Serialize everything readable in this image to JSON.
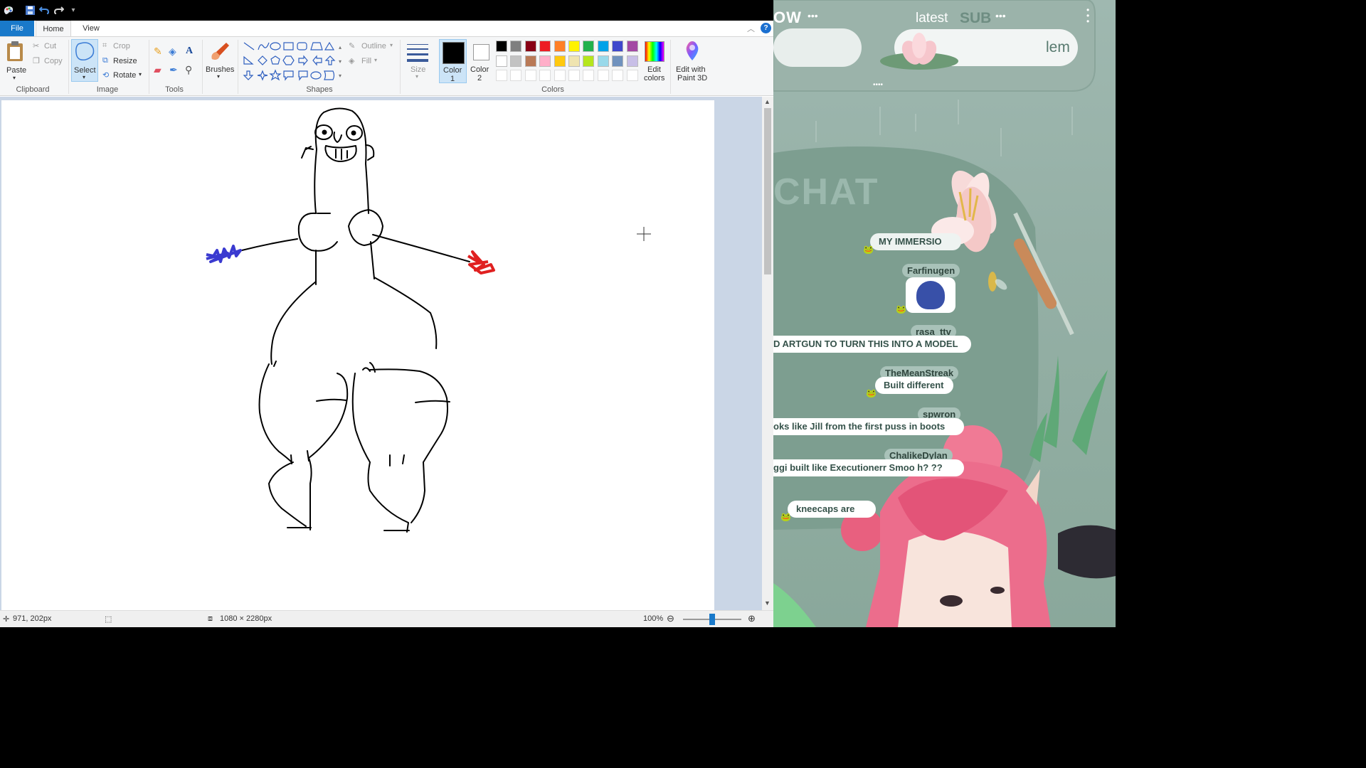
{
  "ribbon": {
    "tabs": [
      "File",
      "Home",
      "View"
    ],
    "clipboard": {
      "paste": "Paste",
      "cut": "Cut",
      "copy": "Copy",
      "group": "Clipboard"
    },
    "image": {
      "select": "Select",
      "crop": "Crop",
      "resize": "Resize",
      "rotate": "Rotate",
      "group": "Image"
    },
    "tools": {
      "group": "Tools"
    },
    "brushes": "Brushes",
    "shapes": {
      "outline": "Outline",
      "fill": "Fill",
      "group": "Shapes"
    },
    "size": "Size",
    "color1": {
      "line1": "Color",
      "line2": "1"
    },
    "color2": {
      "line1": "Color",
      "line2": "2"
    },
    "colors_group": "Colors",
    "edit_colors": {
      "line1": "Edit",
      "line2": "colors"
    },
    "paint3d": {
      "line1": "Edit with",
      "line2": "Paint 3D"
    },
    "palette": [
      "#000000",
      "#7f7f7f",
      "#880015",
      "#ed1c24",
      "#ff7f27",
      "#fff200",
      "#22b14c",
      "#00a2e8",
      "#3f48cc",
      "#a349a4",
      "#ffffff",
      "#c3c3c3",
      "#b97a57",
      "#ffaec9",
      "#ffc90e",
      "#efe4b0",
      "#b5e61d",
      "#99d9ea",
      "#7092be",
      "#c8bfe7"
    ],
    "color1_value": "#000000",
    "color2_value": "#ffffff"
  },
  "status": {
    "cursor": "971, 202px",
    "dimensions": "1080 × 2280px",
    "zoom": "100%",
    "zoom_fraction": 0.5
  },
  "overlay": {
    "top_left_text": "OW",
    "latest": "latest",
    "sub": "SUB",
    "sub_name": "lem",
    "chat_title": "CHAT",
    "messages": [
      {
        "user": "",
        "text": "MY IMMERSIO"
      },
      {
        "user": "Farfinugen",
        "text": ""
      },
      {
        "user": "rasa_ttv",
        "text": "D ARTGUN TO TURN THIS INTO A MODEL"
      },
      {
        "user": "TheMeanStreak",
        "text": "Built different"
      },
      {
        "user": "spwron",
        "text": "oks like Jill from the first puss in boots"
      },
      {
        "user": "ChalikeDylan",
        "text": "ggi built like Executionerr Smoo h? ??"
      },
      {
        "user": "",
        "text": "kneecaps are"
      }
    ]
  }
}
